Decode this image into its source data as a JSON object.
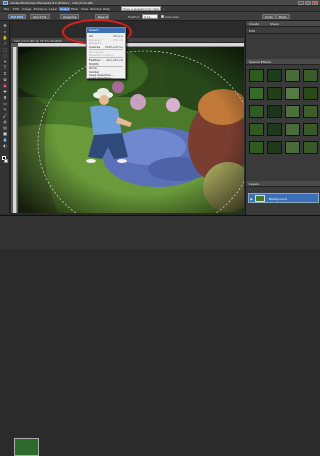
{
  "window": {
    "title": "Adobe Photoshop Elements 6.0 (Editor) - 100_0112.JPG"
  },
  "menubar": {
    "items": [
      "File",
      "Edit",
      "Image",
      "Enhance",
      "Layer",
      "Select",
      "Filter",
      "View",
      "Window",
      "Help"
    ],
    "search_placeholder": "Type a question for help"
  },
  "toolbar": {
    "full_edit": "Full Edit",
    "quick_fix": "Quick Fix",
    "organize": "Organize",
    "undo": "Undo",
    "redo": "Redo"
  },
  "options": {
    "new_selection": "New Selection",
    "feather_label": "Feather:",
    "feather_value": "0 px",
    "anti_alias": "Anti-alias"
  },
  "document": {
    "tab": "100_0112.JPG @ 33.3% (RGB/8)"
  },
  "select_menu": {
    "header": "Select",
    "items": [
      {
        "label": "All",
        "shortcut": "Ctrl+A",
        "enabled": true
      },
      {
        "label": "Deselect",
        "shortcut": "Ctrl+D",
        "enabled": false
      },
      {
        "label": "Reselect",
        "shortcut": "",
        "enabled": false
      },
      {
        "label": "Inverse",
        "shortcut": "Shift+Ctrl+I",
        "enabled": true
      },
      {
        "label": "All Layers",
        "shortcut": "",
        "enabled": false
      },
      {
        "label": "Deselect Layers",
        "shortcut": "",
        "enabled": false
      },
      {
        "label": "Feather...",
        "shortcut": "Alt+Ctrl+D",
        "enabled": true
      },
      {
        "label": "Modify",
        "shortcut": "",
        "enabled": true
      },
      {
        "label": "Grow",
        "shortcut": "",
        "enabled": true
      },
      {
        "label": "Similar",
        "shortcut": "",
        "enabled": true
      },
      {
        "label": "Save Selection...",
        "shortcut": "",
        "enabled": true
      },
      {
        "label": "Load Selection...",
        "shortcut": "",
        "enabled": true
      },
      {
        "label": "Delete Selection...",
        "shortcut": "",
        "enabled": true
      }
    ]
  },
  "panels": {
    "create": "Create",
    "share": "Share",
    "edit": "Edit",
    "effects_title": "Special Effects",
    "layers_title": "Layers",
    "layer_name": "Background"
  },
  "colors": {
    "highlight_ring": "#e31b1b",
    "selection_blue": "#3d6fb8"
  }
}
